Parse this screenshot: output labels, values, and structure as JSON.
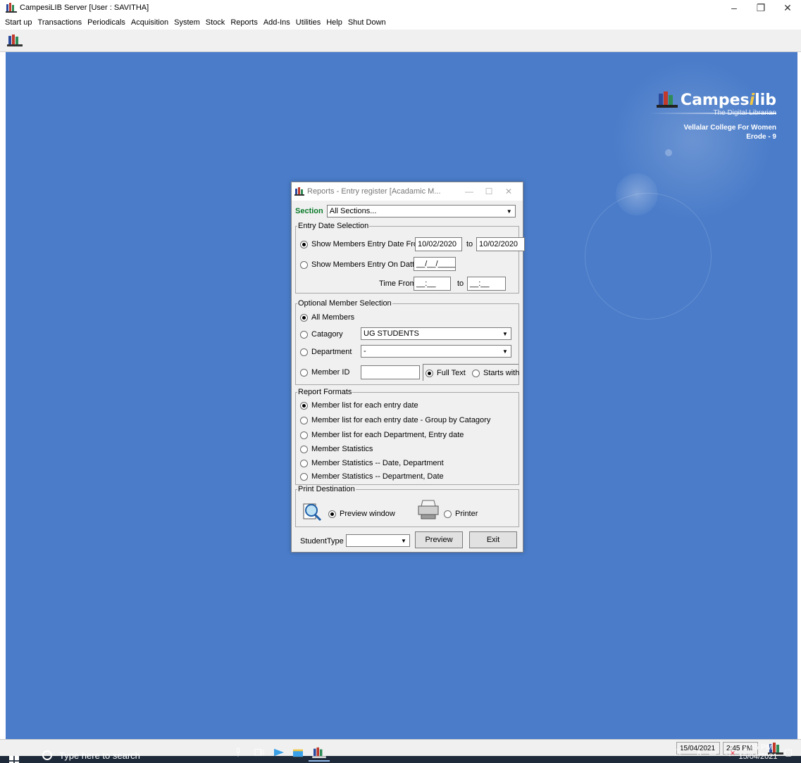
{
  "window": {
    "title": "CampesiLIB Server [User : SAVITHA]",
    "controls": {
      "minimize": "–",
      "restore": "❐",
      "close": "✕"
    }
  },
  "menu": [
    "Start up",
    "Transactions",
    "Periodicals",
    "Acquisition",
    "System",
    "Stock",
    "Reports",
    "Add-Ins",
    "Utilities",
    "Help",
    "Shut Down"
  ],
  "brand": {
    "name_prefix": "Campes",
    "name_i": "i",
    "name_suffix": "lib",
    "tagline": "The Digital Librarian",
    "college": "Vellalar College For Women",
    "city": "Erode - 9"
  },
  "dialog": {
    "title": "Reports - Entry register [Acadamic M...",
    "section_label": "Section",
    "section_value": "All Sections...",
    "entry_date": {
      "legend": "Entry Date Selection",
      "opt_from": "Show Members Entry Date From",
      "from_value": "10/02/2020",
      "to_label": "to",
      "to_value": "10/02/2020",
      "opt_on": "Show Members Entry On Datte",
      "on_value": "__/__/____",
      "time_from_label": "Time From",
      "time_from_value": "__:__",
      "time_to_label": "to",
      "time_to_value": "__:__"
    },
    "member_selection": {
      "legend": "Optional Member Selection",
      "all_members": "All Members",
      "category_label": "Catagory",
      "category_value": "UG STUDENTS",
      "department_label": "Department",
      "department_value": "-",
      "member_id_label": "Member ID",
      "member_id_value": "",
      "full_text": "Full Text",
      "starts_with": "Starts with"
    },
    "report_formats": {
      "legend": "Report Formats",
      "options": [
        "Member list for each entry date",
        "Member list for each entry date - Group by Catagory",
        "Member list for each Department, Entry date",
        "Member Statistics",
        "Member Statistics -- Date, Department",
        "Member Statistics -- Department, Date"
      ]
    },
    "print_destination": {
      "legend": "Print Destination",
      "preview_window": "Preview window",
      "printer": "Printer"
    },
    "student_type_label": "StudentType",
    "student_type_value": "",
    "preview_button": "Preview",
    "exit_button": "Exit"
  },
  "status": {
    "date": "15/04/2021",
    "time": "2:45 PM"
  },
  "taskbar": {
    "search_placeholder": "Type here to search",
    "clock_time": "2:45 PM",
    "clock_date": "15/04/2021"
  },
  "colors": {
    "desktop": "#4a7cc9",
    "section_label": "#0a7a2a",
    "brand_accent": "#f2c744"
  }
}
